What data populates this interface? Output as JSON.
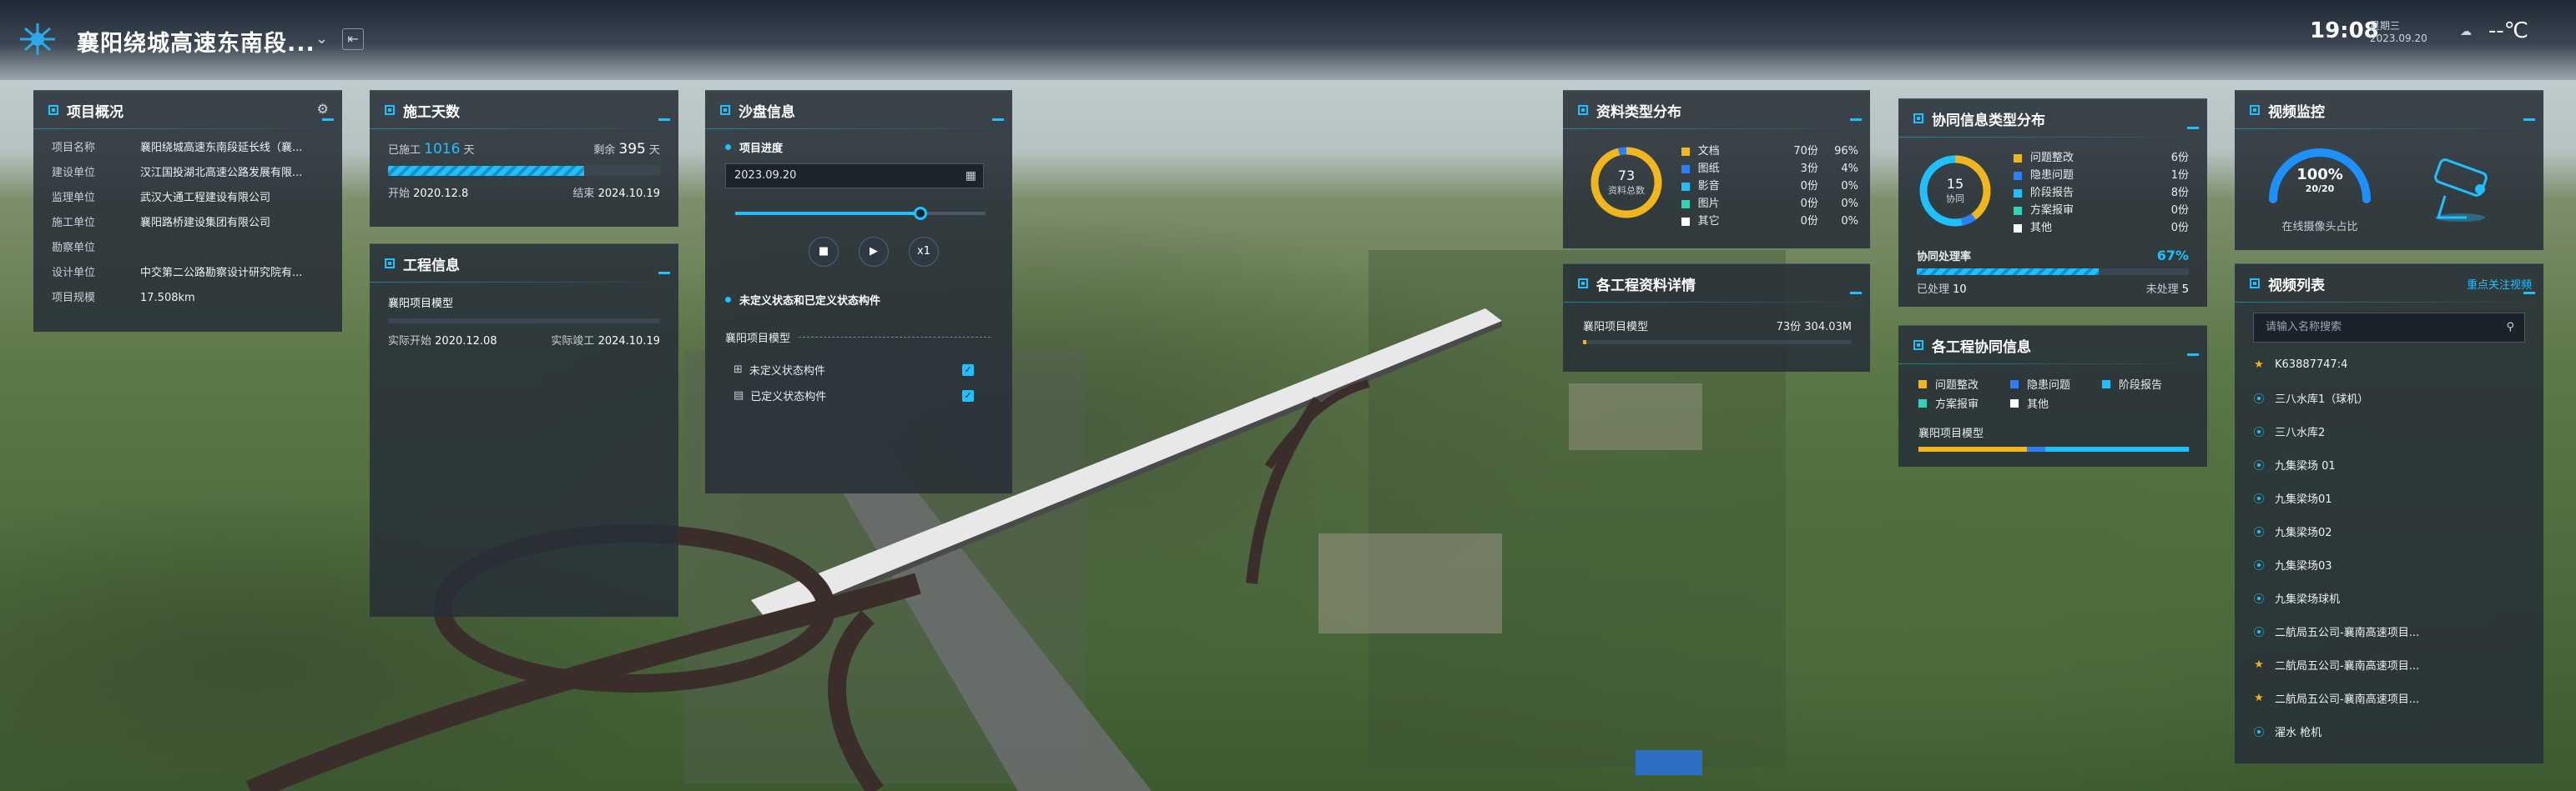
{
  "header": {
    "title": "襄阳绕城高速东南段...",
    "time": "19:08",
    "weekday": "星期三",
    "date": "2023.09.20",
    "temperature": "--℃"
  },
  "project_overview": {
    "title": "项目概况",
    "rows": [
      {
        "label": "项目名称",
        "value": "襄阳绕城高速东南段延长线（襄..."
      },
      {
        "label": "建设单位",
        "value": "汉江国投湖北高速公路发展有限..."
      },
      {
        "label": "监理单位",
        "value": "武汉大通工程建设有限公司"
      },
      {
        "label": "施工单位",
        "value": "襄阳路桥建设集团有限公司"
      },
      {
        "label": "勘察单位",
        "value": ""
      },
      {
        "label": "设计单位",
        "value": "中交第二公路勘察设计研究院有..."
      },
      {
        "label": "项目规模",
        "value": "17.508km"
      }
    ]
  },
  "construction_days": {
    "title": "施工天数",
    "elapsed_label": "已施工",
    "elapsed_days": "1016",
    "elapsed_unit": "天",
    "remaining_label": "剩余",
    "remaining_days": "395",
    "remaining_unit": "天",
    "progress": 0.72,
    "start_label": "开始",
    "start_date": "2020.12.8",
    "end_label": "结束",
    "end_date": "2024.10.19"
  },
  "engineering_info": {
    "title": "工程信息",
    "model": "襄阳项目模型",
    "actual_start_label": "实际开始",
    "actual_start": "2020.12.08",
    "actual_end_label": "实际竣工",
    "actual_end": "2024.10.19"
  },
  "sandbox": {
    "title": "沙盘信息",
    "progress_label": "项目进度",
    "date_value": "2023.09.20",
    "slider_value": 0.74,
    "speed": "x1",
    "state_label": "未定义状态和已定义状态构件",
    "model": "襄阳项目模型",
    "undefined_label": "未定义状态构件",
    "defined_label": "已定义状态构件"
  },
  "doc_types": {
    "title": "资料类型分布",
    "total": "73",
    "total_label": "资料总数",
    "items": [
      {
        "name": "文档",
        "count": "70份",
        "pct": "96%",
        "color": "#f2b51b"
      },
      {
        "name": "图纸",
        "count": "3份",
        "pct": "4%",
        "color": "#2d7ff9"
      },
      {
        "name": "影音",
        "count": "0份",
        "pct": "0%",
        "color": "#1ec0ff"
      },
      {
        "name": "图片",
        "count": "0份",
        "pct": "0%",
        "color": "#2fd3b5"
      },
      {
        "name": "其它",
        "count": "0份",
        "pct": "0%",
        "color": "#ffffff"
      }
    ]
  },
  "doc_details": {
    "title": "各工程资料详情",
    "model": "襄阳项目模型",
    "value": "73份 304.03M"
  },
  "collab_types": {
    "title": "协同信息类型分布",
    "total": "15",
    "total_label": "协同",
    "items": [
      {
        "name": "问题整改",
        "count": "6份",
        "color": "#f2b51b"
      },
      {
        "name": "隐患问题",
        "count": "1份",
        "color": "#2d7ff9"
      },
      {
        "name": "阶段报告",
        "count": "8份",
        "color": "#1ec0ff"
      },
      {
        "name": "方案报审",
        "count": "0份",
        "color": "#2fd3b5"
      },
      {
        "name": "其他",
        "count": "0份",
        "color": "#ffffff"
      }
    ],
    "rate_label": "协同处理率",
    "rate": "67%",
    "rate_value": 0.67,
    "done_label": "已处理",
    "done": "10",
    "todo_label": "未处理",
    "todo": "5"
  },
  "collab_info": {
    "title": "各工程协同信息",
    "legend": [
      {
        "name": "问题整改",
        "color": "#f2b51b"
      },
      {
        "name": "隐患问题",
        "color": "#2d7ff9"
      },
      {
        "name": "阶段报告",
        "color": "#1ec0ff"
      },
      {
        "name": "方案报审",
        "color": "#2fd3b5"
      },
      {
        "name": "其他",
        "color": "#ffffff"
      }
    ],
    "model": "襄阳项目模型"
  },
  "video_monitor": {
    "title": "视频监控",
    "percent": "100%",
    "ratio": "20/20",
    "caption": "在线摄像头占比"
  },
  "video_list": {
    "title": "视频列表",
    "focus_link": "重点关注视频",
    "search_placeholder": "请输入名称搜索",
    "items": [
      {
        "name": "K63887747:4",
        "icon": "star"
      },
      {
        "name": "三八水库1（球机）",
        "icon": "pin"
      },
      {
        "name": "三八水库2",
        "icon": "pin"
      },
      {
        "name": "九集梁场 01",
        "icon": "pin"
      },
      {
        "name": "九集梁场01",
        "icon": "pin"
      },
      {
        "name": "九集梁场02",
        "icon": "pin"
      },
      {
        "name": "九集梁场03",
        "icon": "pin"
      },
      {
        "name": "九集梁场球机",
        "icon": "pin"
      },
      {
        "name": "二航局五公司-襄南高速项目...",
        "icon": "pin"
      },
      {
        "name": "二航局五公司-襄南高速项目...",
        "icon": "star"
      },
      {
        "name": "二航局五公司-襄南高速项目...",
        "icon": "star"
      },
      {
        "name": "濯水 枪机",
        "icon": "pin"
      }
    ]
  }
}
